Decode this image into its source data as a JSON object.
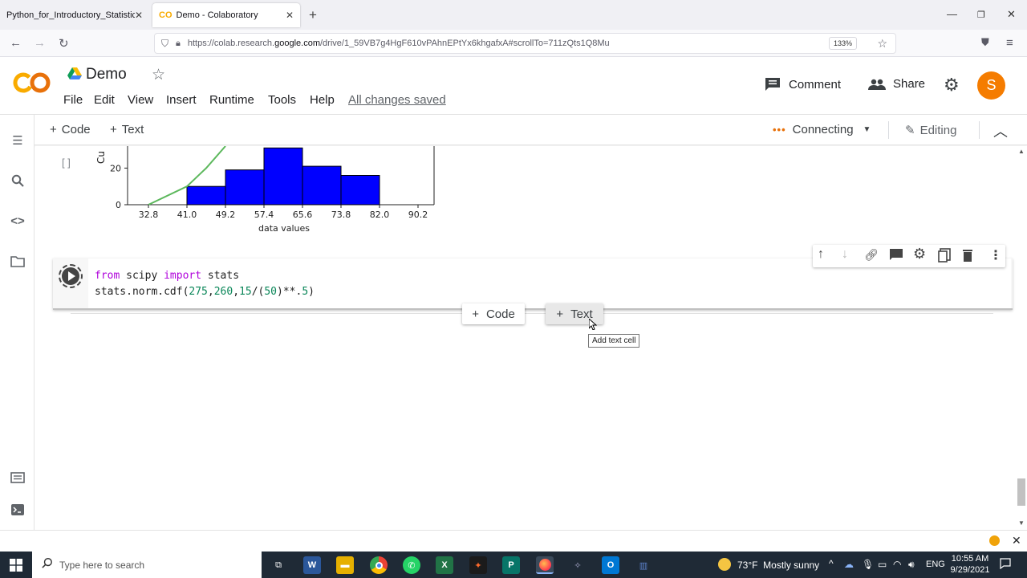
{
  "browser": {
    "tabs": [
      {
        "title": "Python_for_Introductory_Statistics_V"
      },
      {
        "title": "Demo - Colaboratory"
      }
    ],
    "url_prefix": "https://colab.research.",
    "url_domain": "google.com",
    "url_suffix": "/drive/1_59VB7g4HgF610vPAhnEPtYx6khgafxA#scrollTo=711zQts1Q8Mu",
    "zoom": "133%"
  },
  "colab": {
    "logo": "CO",
    "notebook_title": "Demo",
    "menu": [
      "File",
      "Edit",
      "View",
      "Insert",
      "Runtime",
      "Tools",
      "Help"
    ],
    "save_status": "All changes saved",
    "comment_label": "Comment",
    "share_label": "Share",
    "avatar_letter": "S",
    "add_code": "Code",
    "add_text": "Text",
    "connecting": "Connecting",
    "editing": "Editing"
  },
  "cell_output": {
    "exec_marker": "[ ]",
    "ylabel_fragment": "Cu"
  },
  "chart_data": {
    "type": "bar",
    "xlabel": "data values",
    "ylabel": "Cu",
    "x_ticks": [
      "32.8",
      "41.0",
      "49.2",
      "57.4",
      "65.6",
      "73.8",
      "82.0",
      "90.2"
    ],
    "y_ticks": [
      "0",
      "20"
    ],
    "bins": [
      [
        41.0,
        49.2
      ],
      [
        49.2,
        57.4
      ],
      [
        57.4,
        65.6
      ],
      [
        65.6,
        73.8
      ],
      [
        73.8,
        82.0
      ]
    ],
    "values": [
      10,
      19,
      31,
      21,
      16
    ],
    "ylim": [
      0,
      32
    ],
    "cumulative_line": [
      [
        32.8,
        0
      ],
      [
        41.0,
        10
      ],
      [
        45.1,
        20
      ],
      [
        49.2,
        32
      ]
    ],
    "bar_color": "#0000ff",
    "line_color": "#5cb85c"
  },
  "code_cell": {
    "line1": [
      {
        "t": "from",
        "c": "kw"
      },
      {
        "t": " scipy ",
        "c": ""
      },
      {
        "t": "import",
        "c": "kw"
      },
      {
        "t": " stats",
        "c": ""
      }
    ],
    "line2": [
      {
        "t": "stats.norm.cdf(",
        "c": ""
      },
      {
        "t": "275",
        "c": "num"
      },
      {
        "t": ",",
        "c": ""
      },
      {
        "t": "260",
        "c": "num"
      },
      {
        "t": ",",
        "c": ""
      },
      {
        "t": "15",
        "c": "num"
      },
      {
        "t": "/(",
        "c": ""
      },
      {
        "t": "50",
        "c": "num"
      },
      {
        "t": ")**.",
        "c": ""
      },
      {
        "t": "5",
        "c": "num"
      },
      {
        "t": ")",
        "c": ""
      }
    ]
  },
  "insert_buttons": {
    "code": "Code",
    "text": "Text",
    "tooltip": "Add text cell"
  },
  "taskbar": {
    "search_placeholder": "Type here to search",
    "weather": "73°F  Mostly sunny",
    "lang": "ENG",
    "time": "10:55 AM",
    "date": "9/29/2021"
  }
}
